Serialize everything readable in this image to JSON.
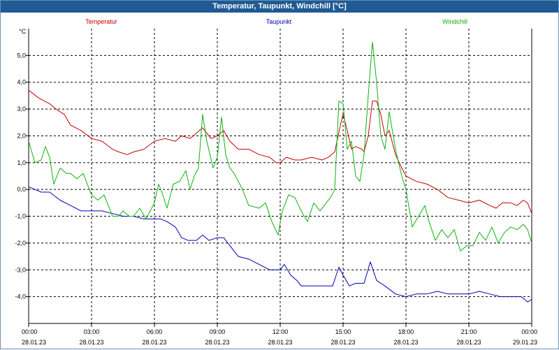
{
  "window": {
    "title": "Temperatur, Taupunkt, Windchill [°C]"
  },
  "chart_data": {
    "type": "line",
    "title": "Temperatur, Taupunkt, Windchill [°C]",
    "unit_label": "°C",
    "grid": true,
    "legend_position": "top",
    "ylim": [
      -5.0,
      6.0
    ],
    "y_ticks": [
      {
        "value": 5,
        "label": "5,0"
      },
      {
        "value": 4,
        "label": "4,0"
      },
      {
        "value": 3,
        "label": "3,0"
      },
      {
        "value": 2,
        "label": "2,0"
      },
      {
        "value": 1,
        "label": "1,0"
      },
      {
        "value": 0,
        "label": "0,0"
      },
      {
        "value": -1,
        "label": "-1,0"
      },
      {
        "value": -2,
        "label": "-2,0"
      },
      {
        "value": -3,
        "label": "-3,0"
      },
      {
        "value": -4,
        "label": "-4,0"
      }
    ],
    "xlim": [
      0,
      24
    ],
    "x_ticks": [
      {
        "value": 0,
        "time": "00:00",
        "date": "28.01.23"
      },
      {
        "value": 3,
        "time": "03:00",
        "date": "28.01.23"
      },
      {
        "value": 6,
        "time": "06:00",
        "date": "28.01.23"
      },
      {
        "value": 9,
        "time": "09:00",
        "date": "28.01.23"
      },
      {
        "value": 12,
        "time": "12:00",
        "date": "28.01.23"
      },
      {
        "value": 15,
        "time": "15:00",
        "date": "28.01.23"
      },
      {
        "value": 18,
        "time": "18:00",
        "date": "28.01.23"
      },
      {
        "value": 21,
        "time": "21:00",
        "date": "28.01.23"
      },
      {
        "value": 24,
        "time": "00:00",
        "date": "29.01.23"
      }
    ],
    "series": [
      {
        "name": "Temperatur",
        "color": "#c00000",
        "points": [
          [
            0,
            3.7
          ],
          [
            0.5,
            3.4
          ],
          [
            1,
            3.2
          ],
          [
            1.3,
            3.0
          ],
          [
            1.7,
            2.8
          ],
          [
            2,
            2.4
          ],
          [
            2.5,
            2.2
          ],
          [
            3,
            1.9
          ],
          [
            3.5,
            1.8
          ],
          [
            4,
            1.5
          ],
          [
            4.3,
            1.4
          ],
          [
            4.7,
            1.3
          ],
          [
            5,
            1.4
          ],
          [
            5.5,
            1.5
          ],
          [
            6,
            1.8
          ],
          [
            6.5,
            1.9
          ],
          [
            7,
            1.8
          ],
          [
            7.3,
            2.0
          ],
          [
            7.7,
            1.9
          ],
          [
            8,
            2.1
          ],
          [
            8.3,
            2.3
          ],
          [
            8.7,
            1.9
          ],
          [
            9,
            2.0
          ],
          [
            9.3,
            2.2
          ],
          [
            9.6,
            1.8
          ],
          [
            10,
            1.5
          ],
          [
            10.5,
            1.5
          ],
          [
            11,
            1.3
          ],
          [
            11.5,
            1.2
          ],
          [
            11.8,
            1.0
          ],
          [
            12,
            1.0
          ],
          [
            12.3,
            1.2
          ],
          [
            12.7,
            1.1
          ],
          [
            13,
            1.1
          ],
          [
            13.5,
            1.2
          ],
          [
            14,
            1.1
          ],
          [
            14.3,
            1.2
          ],
          [
            14.6,
            1.4
          ],
          [
            14.9,
            2.5
          ],
          [
            15,
            2.8
          ],
          [
            15.2,
            2.2
          ],
          [
            15.4,
            1.5
          ],
          [
            15.6,
            1.6
          ],
          [
            15.9,
            1.5
          ],
          [
            16,
            1.4
          ],
          [
            16.2,
            2.0
          ],
          [
            16.4,
            3.3
          ],
          [
            16.6,
            3.3
          ],
          [
            16.8,
            2.8
          ],
          [
            17,
            2.0
          ],
          [
            17.2,
            2.2
          ],
          [
            17.5,
            1.3
          ],
          [
            17.8,
            0.8
          ],
          [
            18,
            0.5
          ],
          [
            18.5,
            0.3
          ],
          [
            19,
            0.2
          ],
          [
            19.5,
            0.0
          ],
          [
            20,
            -0.3
          ],
          [
            20.5,
            -0.4
          ],
          [
            21,
            -0.5
          ],
          [
            21.5,
            -0.4
          ],
          [
            22,
            -0.6
          ],
          [
            22.3,
            -0.7
          ],
          [
            22.6,
            -0.5
          ],
          [
            23,
            -0.5
          ],
          [
            23.3,
            -0.6
          ],
          [
            23.6,
            -0.4
          ],
          [
            23.8,
            -0.5
          ],
          [
            24,
            -0.9
          ]
        ]
      },
      {
        "name": "Taupunkt",
        "color": "#0000b0",
        "points": [
          [
            0,
            0.1
          ],
          [
            0.3,
            0.0
          ],
          [
            0.6,
            -0.1
          ],
          [
            1,
            -0.1
          ],
          [
            1.5,
            -0.4
          ],
          [
            2,
            -0.6
          ],
          [
            2.5,
            -0.8
          ],
          [
            3,
            -0.8
          ],
          [
            3.5,
            -0.8
          ],
          [
            4,
            -0.9
          ],
          [
            4.5,
            -1.0
          ],
          [
            5,
            -1.0
          ],
          [
            5.5,
            -1.1
          ],
          [
            6,
            -1.1
          ],
          [
            6.3,
            -1.1
          ],
          [
            6.6,
            -1.2
          ],
          [
            7,
            -1.4
          ],
          [
            7.3,
            -1.8
          ],
          [
            7.6,
            -1.9
          ],
          [
            8,
            -1.9
          ],
          [
            8.3,
            -1.7
          ],
          [
            8.6,
            -1.9
          ],
          [
            9,
            -1.8
          ],
          [
            9.3,
            -1.8
          ],
          [
            9.6,
            -2.1
          ],
          [
            10,
            -2.5
          ],
          [
            10.5,
            -2.6
          ],
          [
            11,
            -2.8
          ],
          [
            11.5,
            -3.0
          ],
          [
            12,
            -3.0
          ],
          [
            12.2,
            -2.8
          ],
          [
            12.5,
            -3.2
          ],
          [
            12.8,
            -3.4
          ],
          [
            13,
            -3.6
          ],
          [
            13.5,
            -3.6
          ],
          [
            14,
            -3.6
          ],
          [
            14.5,
            -3.6
          ],
          [
            14.8,
            -2.9
          ],
          [
            15,
            -3.2
          ],
          [
            15.3,
            -3.6
          ],
          [
            15.6,
            -3.5
          ],
          [
            16,
            -3.5
          ],
          [
            16.3,
            -2.7
          ],
          [
            16.6,
            -3.4
          ],
          [
            17,
            -3.6
          ],
          [
            17.5,
            -3.9
          ],
          [
            18,
            -4.0
          ],
          [
            18.5,
            -3.9
          ],
          [
            19,
            -3.9
          ],
          [
            19.5,
            -3.8
          ],
          [
            20,
            -3.9
          ],
          [
            20.5,
            -3.9
          ],
          [
            21,
            -3.9
          ],
          [
            21.5,
            -3.8
          ],
          [
            22,
            -3.9
          ],
          [
            22.5,
            -4.0
          ],
          [
            23,
            -4.0
          ],
          [
            23.5,
            -4.0
          ],
          [
            23.8,
            -4.2
          ],
          [
            24,
            -4.1
          ]
        ]
      },
      {
        "name": "Windchill",
        "color": "#10b010",
        "points": [
          [
            0,
            1.8
          ],
          [
            0.3,
            1.0
          ],
          [
            0.6,
            1.1
          ],
          [
            0.8,
            1.6
          ],
          [
            1,
            1.2
          ],
          [
            1.2,
            0.2
          ],
          [
            1.5,
            0.8
          ],
          [
            1.8,
            0.6
          ],
          [
            2,
            0.6
          ],
          [
            2.3,
            0.4
          ],
          [
            2.6,
            0.6
          ],
          [
            3,
            -0.2
          ],
          [
            3.3,
            -0.4
          ],
          [
            3.6,
            -0.2
          ],
          [
            3.8,
            -0.6
          ],
          [
            4,
            -1.0
          ],
          [
            4.3,
            -1.0
          ],
          [
            4.5,
            -0.8
          ],
          [
            4.8,
            -1.0
          ],
          [
            5,
            -1.0
          ],
          [
            5.3,
            -0.7
          ],
          [
            5.6,
            -1.1
          ],
          [
            5.8,
            -0.8
          ],
          [
            6,
            -0.5
          ],
          [
            6.2,
            0.2
          ],
          [
            6.4,
            -0.2
          ],
          [
            6.6,
            -0.7
          ],
          [
            6.9,
            0.2
          ],
          [
            7.2,
            0.3
          ],
          [
            7.5,
            0.7
          ],
          [
            7.7,
            0.0
          ],
          [
            7.9,
            0.5
          ],
          [
            8.1,
            0.8
          ],
          [
            8.3,
            2.8
          ],
          [
            8.5,
            1.8
          ],
          [
            8.8,
            0.8
          ],
          [
            9,
            1.2
          ],
          [
            9.2,
            2.7
          ],
          [
            9.4,
            1.3
          ],
          [
            9.6,
            0.8
          ],
          [
            9.8,
            0.6
          ],
          [
            10.2,
            0.0
          ],
          [
            10.5,
            -0.6
          ],
          [
            11,
            -0.7
          ],
          [
            11.3,
            -0.5
          ],
          [
            11.6,
            -1.2
          ],
          [
            11.9,
            -1.7
          ],
          [
            12.1,
            -0.8
          ],
          [
            12.4,
            -0.2
          ],
          [
            12.7,
            -0.3
          ],
          [
            13,
            -0.8
          ],
          [
            13.3,
            -1.2
          ],
          [
            13.6,
            -0.5
          ],
          [
            13.9,
            -0.8
          ],
          [
            14.1,
            -0.6
          ],
          [
            14.4,
            -0.3
          ],
          [
            14.6,
            0.0
          ],
          [
            14.8,
            3.3
          ],
          [
            15,
            3.2
          ],
          [
            15.2,
            1.5
          ],
          [
            15.4,
            1.8
          ],
          [
            15.6,
            0.5
          ],
          [
            15.8,
            0.3
          ],
          [
            16,
            1.3
          ],
          [
            16.2,
            3.5
          ],
          [
            16.4,
            5.5
          ],
          [
            16.6,
            4.0
          ],
          [
            16.8,
            2.0
          ],
          [
            17,
            1.5
          ],
          [
            17.2,
            2.9
          ],
          [
            17.5,
            1.5
          ],
          [
            17.8,
            0.5
          ],
          [
            18,
            0.0
          ],
          [
            18.3,
            -1.4
          ],
          [
            18.6,
            -1.0
          ],
          [
            18.9,
            -0.6
          ],
          [
            19.1,
            -1.2
          ],
          [
            19.4,
            -1.9
          ],
          [
            19.7,
            -1.5
          ],
          [
            20,
            -1.8
          ],
          [
            20.3,
            -1.5
          ],
          [
            20.6,
            -2.3
          ],
          [
            20.9,
            -2.1
          ],
          [
            21.2,
            -2.1
          ],
          [
            21.5,
            -1.6
          ],
          [
            21.8,
            -1.9
          ],
          [
            22.1,
            -1.4
          ],
          [
            22.4,
            -2.0
          ],
          [
            22.7,
            -1.6
          ],
          [
            23,
            -1.4
          ],
          [
            23.3,
            -1.5
          ],
          [
            23.6,
            -1.3
          ],
          [
            23.8,
            -1.5
          ],
          [
            24,
            -2.0
          ]
        ]
      }
    ]
  }
}
